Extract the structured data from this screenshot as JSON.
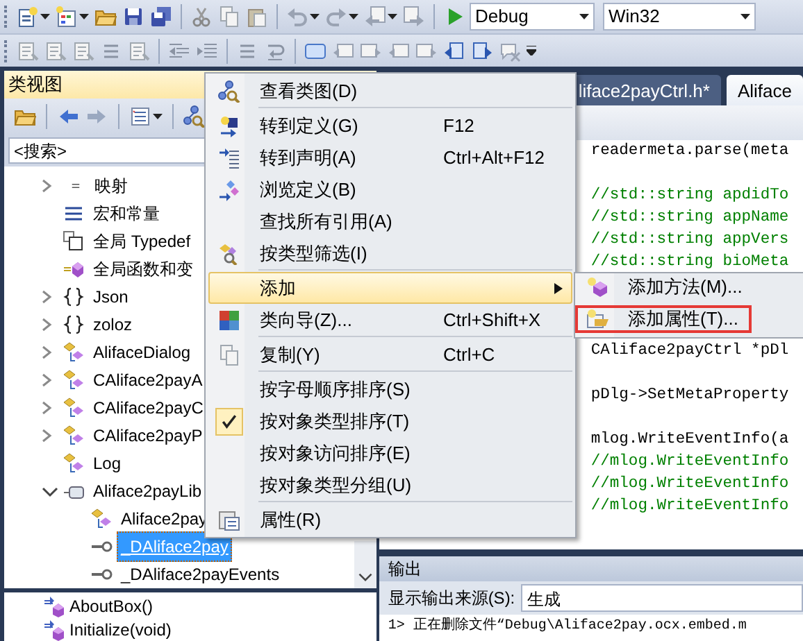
{
  "toolbar": {
    "configuration": "Debug",
    "platform": "Win32"
  },
  "class_view": {
    "title": "类视图",
    "search": {
      "placeholder": "<搜索>"
    },
    "tree": [
      {
        "label": "映射",
        "kind": "mapping",
        "expanded": false,
        "selected": false
      },
      {
        "label": "宏和常量",
        "kind": "macro",
        "selected": false
      },
      {
        "label": "全局 Typedef",
        "kind": "typedef",
        "selected": false
      },
      {
        "label": "全局函数和变",
        "kind": "global",
        "selected": false
      },
      {
        "label": "Json",
        "kind": "namespace",
        "expanded": false,
        "selected": false
      },
      {
        "label": "zoloz",
        "kind": "namespace",
        "expanded": false,
        "selected": false
      },
      {
        "label": "AlifaceDialog",
        "kind": "class",
        "expanded": false,
        "selected": false
      },
      {
        "label": "CAliface2payA",
        "kind": "class",
        "expanded": false,
        "selected": false
      },
      {
        "label": "CAliface2payC",
        "kind": "class",
        "expanded": false,
        "selected": false
      },
      {
        "label": "CAliface2payP",
        "kind": "class",
        "expanded": false,
        "selected": false
      },
      {
        "label": "Log",
        "kind": "class",
        "selected": false
      },
      {
        "label": "Aliface2payLib",
        "kind": "library",
        "expanded": true,
        "selected": false,
        "children": [
          {
            "label": "Aliface2pay",
            "kind": "class",
            "selected": false
          },
          {
            "label": "_DAliface2pay",
            "kind": "interface",
            "selected": true
          },
          {
            "label": "_DAliface2payEvents",
            "kind": "interface",
            "selected": false
          }
        ]
      }
    ],
    "members": [
      {
        "label": "AboutBox()"
      },
      {
        "label": "Initialize(void)"
      }
    ]
  },
  "editor": {
    "tabs": [
      {
        "label": "liface2payCtrl.h*",
        "selected": false
      },
      {
        "label": "Aliface",
        "selected": true
      }
    ],
    "code_lines": [
      {
        "kind": "code",
        "text": "readermeta.parse(meta"
      },
      {
        "kind": "blank"
      },
      {
        "kind": "comment",
        "text": "//std::string apdidTo"
      },
      {
        "kind": "comment",
        "text": "//std::string appName"
      },
      {
        "kind": "comment",
        "text": "//std::string appVers"
      },
      {
        "kind": "comment",
        "text": "//std::string bioMeta"
      },
      {
        "kind": "blank"
      },
      {
        "kind": "blank"
      },
      {
        "kind": "blank"
      },
      {
        "kind": "code",
        "text": "CAliface2payCtrl *pDl"
      },
      {
        "kind": "blank"
      },
      {
        "kind": "code",
        "text": "pDlg->SetMetaProperty"
      },
      {
        "kind": "blank"
      },
      {
        "kind": "code",
        "text": "mlog.WriteEventInfo(a"
      },
      {
        "kind": "comment",
        "text": "//mlog.WriteEventInfo"
      },
      {
        "kind": "comment",
        "text": "//mlog.WriteEventInfo"
      },
      {
        "kind": "comment",
        "text": "//mlog.WriteEventInfo"
      }
    ]
  },
  "output": {
    "title": "输出",
    "source_label": "显示输出来源(S):",
    "source_value": "生成",
    "lines": [
      "1>  正在删除文件“Debug\\Aliface2pay.ocx.embed.m"
    ]
  },
  "context_menu": {
    "items": [
      {
        "kind": "item",
        "label": "查看类图(D)",
        "checked": false,
        "selected": false
      },
      {
        "kind": "separator"
      },
      {
        "kind": "item",
        "label": "转到定义(G)",
        "shortcut": "F12",
        "checked": false,
        "selected": false
      },
      {
        "kind": "item",
        "label": "转到声明(A)",
        "shortcut": "Ctrl+Alt+F12",
        "checked": false,
        "selected": false
      },
      {
        "kind": "item",
        "label": "浏览定义(B)",
        "checked": false,
        "selected": false
      },
      {
        "kind": "item",
        "label": "查找所有引用(A)",
        "checked": false,
        "selected": false
      },
      {
        "kind": "item",
        "label": "按类型筛选(I)",
        "checked": false,
        "selected": false
      },
      {
        "kind": "separator"
      },
      {
        "kind": "submenu",
        "label": "添加",
        "checked": false,
        "selected": true
      },
      {
        "kind": "item",
        "label": "类向导(Z)...",
        "shortcut": "Ctrl+Shift+X",
        "checked": false,
        "selected": false
      },
      {
        "kind": "separator"
      },
      {
        "kind": "item",
        "label": "复制(Y)",
        "shortcut": "Ctrl+C",
        "checked": false,
        "selected": false
      },
      {
        "kind": "separator"
      },
      {
        "kind": "item",
        "label": "按字母顺序排序(S)",
        "checked": false,
        "selected": false
      },
      {
        "kind": "item",
        "label": "按对象类型排序(T)",
        "checked": true,
        "selected": false
      },
      {
        "kind": "item",
        "label": "按对象访问排序(E)",
        "checked": false,
        "selected": false
      },
      {
        "kind": "item",
        "label": "按对象类型分组(U)",
        "checked": false,
        "selected": false
      },
      {
        "kind": "separator"
      },
      {
        "kind": "item",
        "label": "属性(R)",
        "checked": false,
        "selected": false
      }
    ]
  },
  "submenu": {
    "items": [
      {
        "label": "添加方法(M)...",
        "outlined": false
      },
      {
        "label": "添加属性(T)...",
        "outlined": true
      }
    ]
  }
}
